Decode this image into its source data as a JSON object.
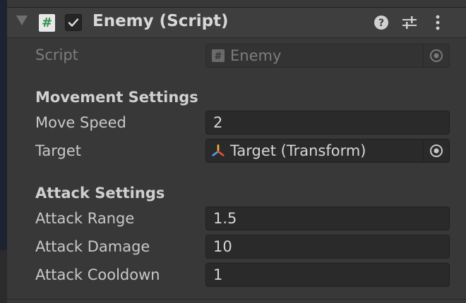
{
  "component": {
    "title": "Enemy (Script)",
    "enabled": true,
    "icons": {
      "foldout": "foldout-arrow-icon",
      "script": "script-hash-icon",
      "help": "help-icon",
      "presets": "presets-sliders-icon",
      "menu": "kebab-menu-icon"
    }
  },
  "script_field": {
    "label": "Script",
    "value": "Enemy",
    "icon": "#"
  },
  "movement": {
    "header": "Movement Settings",
    "move_speed": {
      "label": "Move Speed",
      "value": "2"
    },
    "target": {
      "label": "Target",
      "value": "Target (Transform)",
      "icon": "transform-icon"
    }
  },
  "attack": {
    "header": "Attack Settings",
    "range": {
      "label": "Attack Range",
      "value": "1.5"
    },
    "damage": {
      "label": "Attack Damage",
      "value": "10"
    },
    "cooldown": {
      "label": "Attack Cooldown",
      "value": "1"
    }
  },
  "colors": {
    "panel_bg": "#383838",
    "header_bg": "#3e3e3e",
    "field_bg": "#2a2a2a",
    "script_icon_green": "#2f8f4a"
  }
}
